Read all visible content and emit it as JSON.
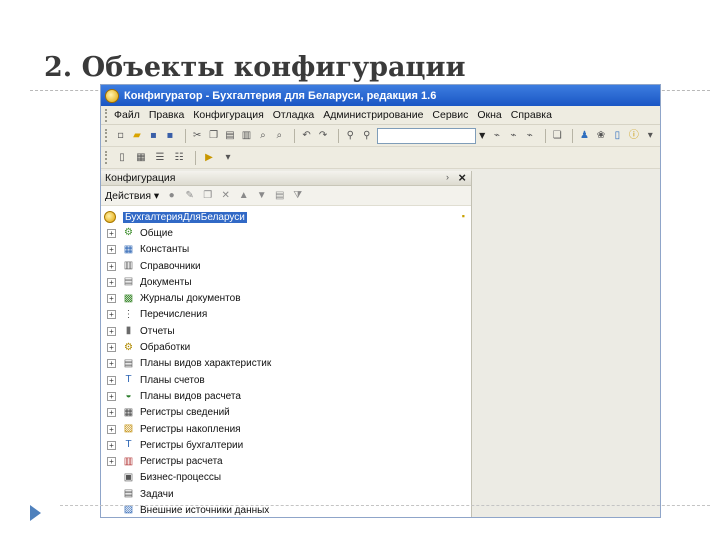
{
  "slide": {
    "title": "2. Объекты конфигурации"
  },
  "window": {
    "title": "Конфигуратор - Бухгалтерия для Беларуси, редакция 1.6"
  },
  "menu": [
    "Файл",
    "Правка",
    "Конфигурация",
    "Отладка",
    "Администрирование",
    "Сервис",
    "Окна",
    "Справка"
  ],
  "panel": {
    "title": "Конфигурация",
    "actions_label": "Действия ▾",
    "root_label": "БухгалтерияДляБеларуси"
  },
  "tree": [
    {
      "label": "Общие",
      "icon": "gears-icon",
      "expandable": true,
      "color": "#3f8f2f"
    },
    {
      "label": "Константы",
      "icon": "constants-icon",
      "expandable": true,
      "color": "#2e66b5"
    },
    {
      "label": "Справочники",
      "icon": "catalog-icon",
      "expandable": true,
      "color": "#5a5a5a"
    },
    {
      "label": "Документы",
      "icon": "document-icon",
      "expandable": true,
      "color": "#6a6a6a"
    },
    {
      "label": "Журналы документов",
      "icon": "journal-icon",
      "expandable": true,
      "color": "#3e8a30"
    },
    {
      "label": "Перечисления",
      "icon": "enum-icon",
      "expandable": true,
      "color": "#555555"
    },
    {
      "label": "Отчеты",
      "icon": "report-icon",
      "expandable": true,
      "color": "#6a6a6a"
    },
    {
      "label": "Обработки",
      "icon": "processing-icon",
      "expandable": true,
      "color": "#b08a00"
    },
    {
      "label": "Планы видов характеристик",
      "icon": "char-plan-icon",
      "expandable": true,
      "color": "#5a5a5a"
    },
    {
      "label": "Планы счетов",
      "icon": "accounts-plan-icon",
      "expandable": true,
      "color": "#2e66b5"
    },
    {
      "label": "Планы видов расчета",
      "icon": "calc-plan-icon",
      "expandable": true,
      "color": "#2f7f2f"
    },
    {
      "label": "Регистры сведений",
      "icon": "info-register-icon",
      "expandable": true,
      "color": "#4a4a4a"
    },
    {
      "label": "Регистры накопления",
      "icon": "accum-register-icon",
      "expandable": true,
      "color": "#c08a00"
    },
    {
      "label": "Регистры бухгалтерии",
      "icon": "acc-register-icon",
      "expandable": true,
      "color": "#2e66b5"
    },
    {
      "label": "Регистры расчета",
      "icon": "calc-register-icon",
      "expandable": true,
      "color": "#b03030"
    },
    {
      "label": "Бизнес-процессы",
      "icon": "business-process-icon",
      "expandable": false,
      "color": "#555555"
    },
    {
      "label": "Задачи",
      "icon": "tasks-icon",
      "expandable": false,
      "color": "#555555"
    },
    {
      "label": "Внешние источники данных",
      "icon": "external-data-icon",
      "expandable": false,
      "color": "#2e66b5"
    }
  ],
  "colors": {
    "titlebar": "#1a56c4",
    "selection": "#3169c6",
    "bullet": "#4f81bd"
  }
}
